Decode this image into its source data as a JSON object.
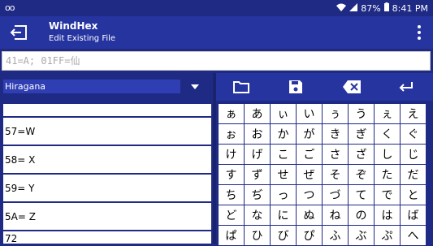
{
  "status": {
    "percent": "87%",
    "time": "8:41 PM"
  },
  "appbar": {
    "title": "WindHex",
    "subtitle": "Edit Existing File"
  },
  "input": {
    "placeholder": "41=A; 01FF=仙"
  },
  "dropdown": {
    "selected": "Hiragana"
  },
  "list": [
    "",
    "57=W",
    "58= X",
    "59= Y",
    "5A= Z",
    "72"
  ],
  "keyboard": [
    [
      "ぁ",
      "あ",
      "ぃ",
      "い",
      "ぅ",
      "う",
      "ぇ",
      "え"
    ],
    [
      "ぉ",
      "お",
      "か",
      "が",
      "き",
      "ぎ",
      "く",
      "ぐ"
    ],
    [
      "け",
      "げ",
      "こ",
      "ご",
      "さ",
      "ざ",
      "し",
      "じ"
    ],
    [
      "す",
      "ず",
      "せ",
      "ぜ",
      "そ",
      "ぞ",
      "た",
      "だ"
    ],
    [
      "ち",
      "ぢ",
      "っ",
      "つ",
      "づ",
      "て",
      "で",
      "と"
    ],
    [
      "ど",
      "な",
      "に",
      "ぬ",
      "ね",
      "の",
      "は",
      "ば"
    ],
    [
      "ぱ",
      "ひ",
      "び",
      "ぴ",
      "ふ",
      "ぶ",
      "ぷ",
      "へ"
    ]
  ],
  "colors": {
    "background": "#1f2a85",
    "appbar": "#2634a0",
    "dropdown": "#2f3fb3"
  }
}
